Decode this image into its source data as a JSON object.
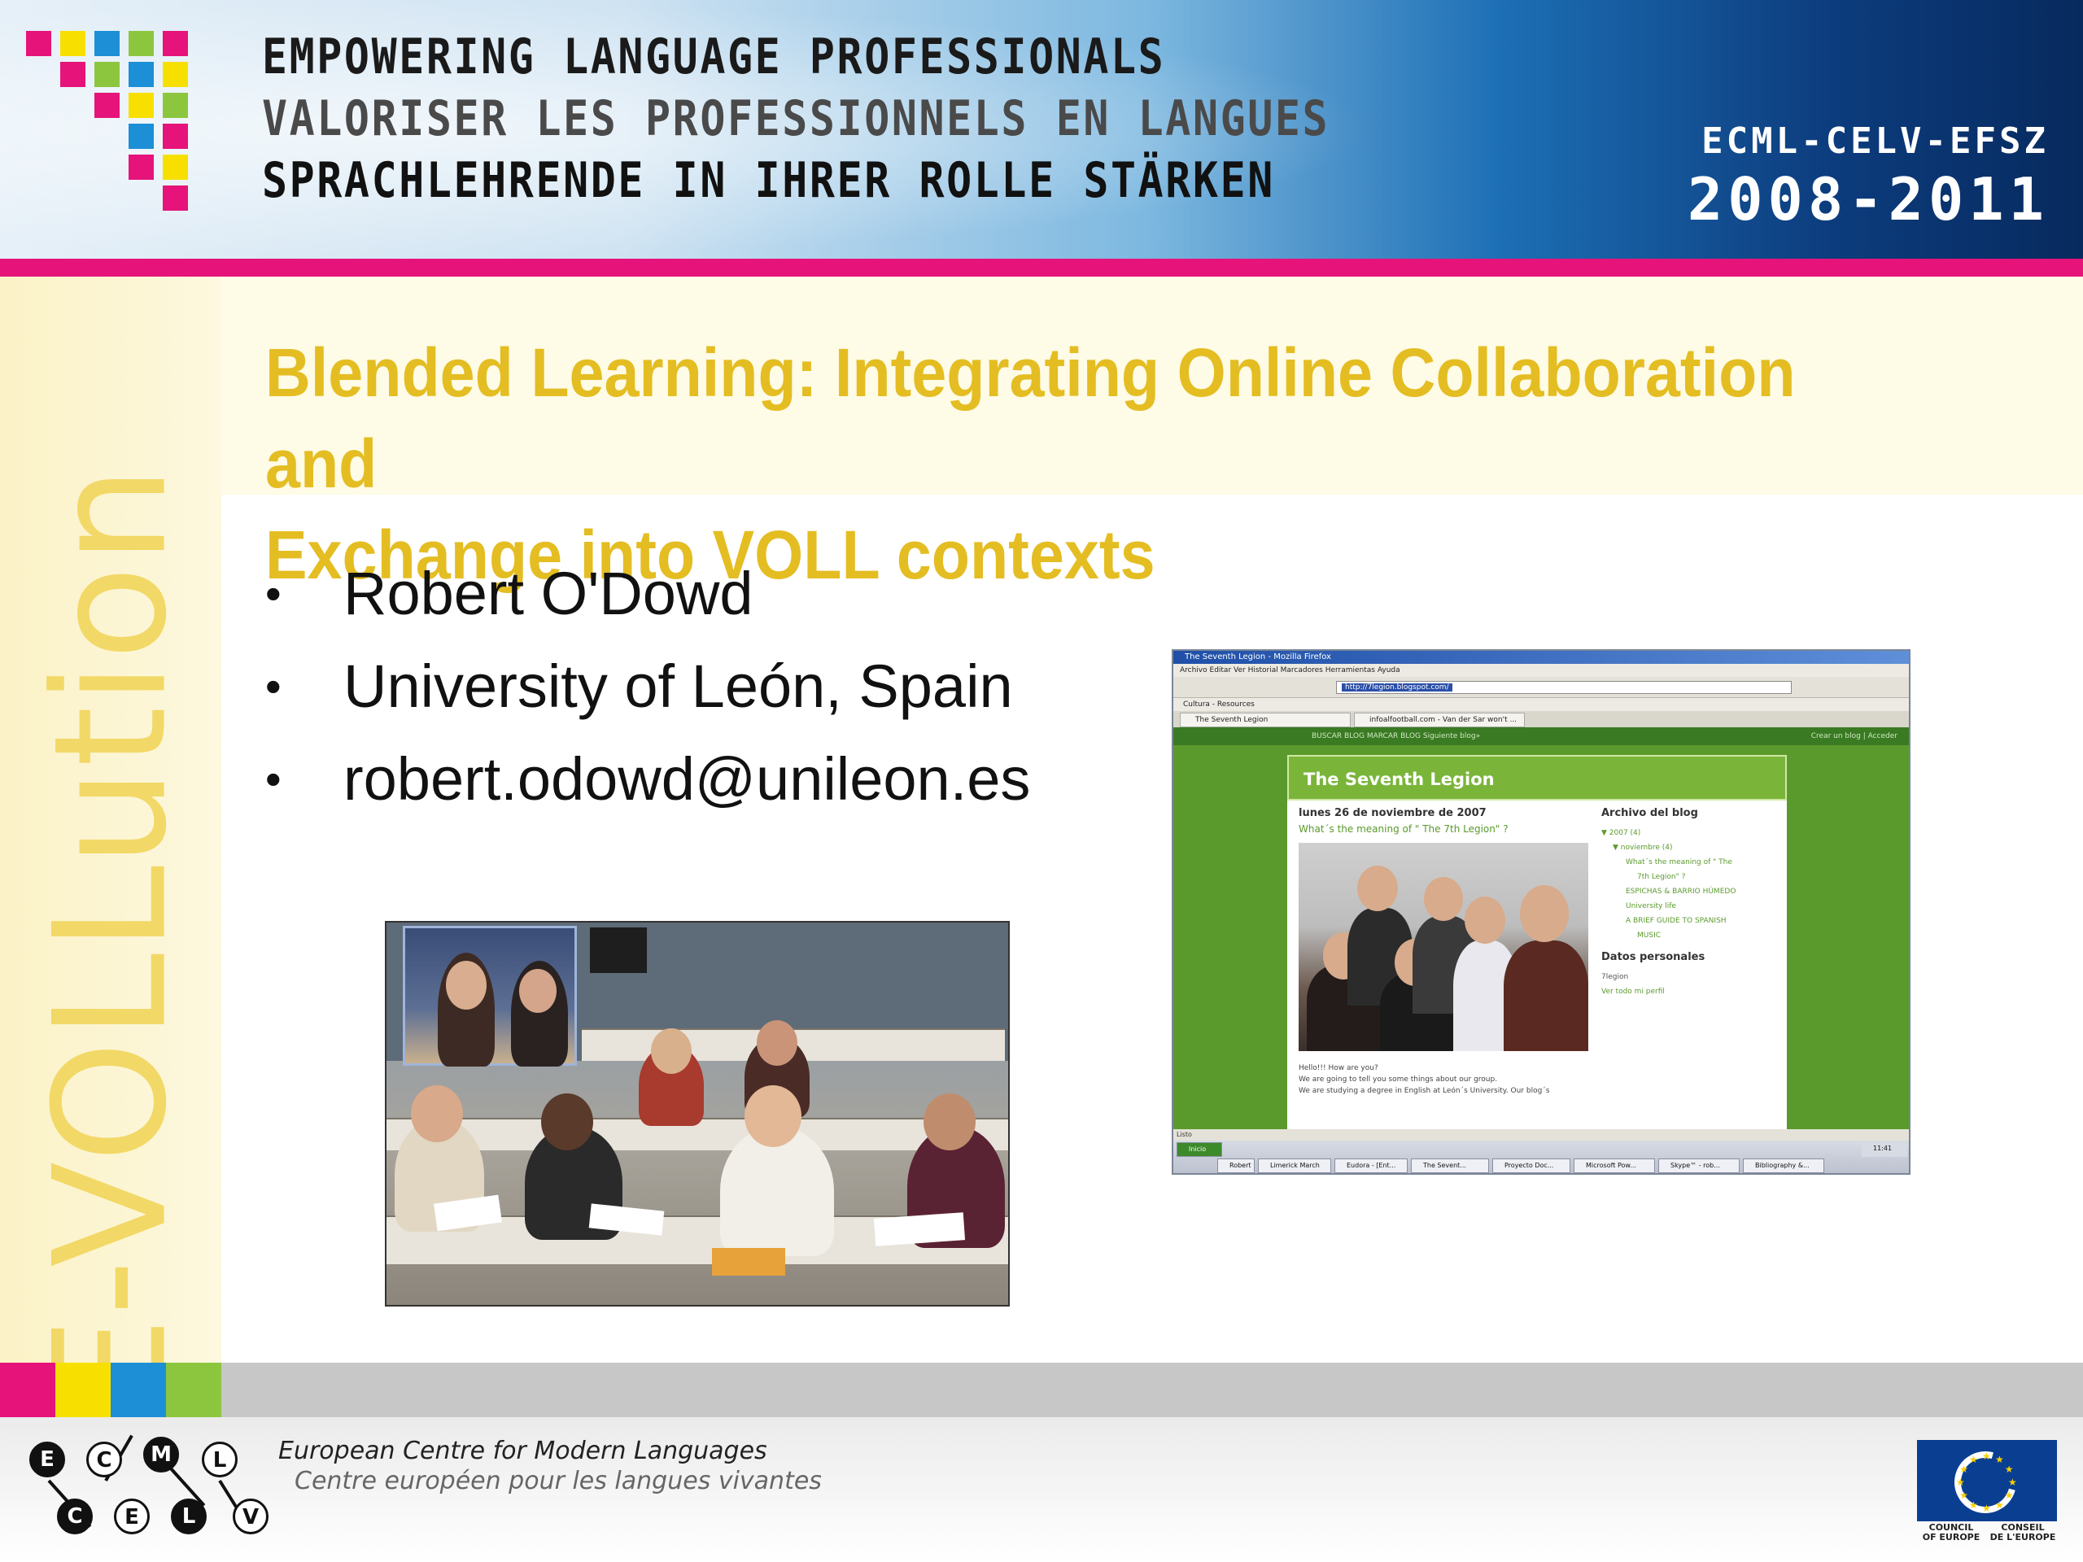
{
  "header": {
    "line1": "EMPOWERING LANGUAGE PROFESSIONALS",
    "line2": "VALORISER LES PROFESSIONNELS EN LANGUES",
    "line3": "SPRACHLEHRENDE IN IHRER ROLLE STÄRKEN",
    "orgs": "ECML-CELV-EFSZ",
    "years": "2008-2011"
  },
  "side_label": "E-VOLLution",
  "slide": {
    "title_line1": "Blended Learning: Integrating Online Collaboration and",
    "title_line2": "Exchange into VOLL contexts",
    "bullets": [
      "Robert O'Dowd",
      "University of León, Spain",
      "robert.odowd@unileon.es"
    ],
    "bullet_glyph": "•"
  },
  "blog_screenshot": {
    "window_title": "The Seventh Legion - Mozilla Firefox",
    "menu": "Archivo   Editar   Ver   Historial   Marcadores   Herramientas   Ayuda",
    "url": "http://7legion.blogspot.com/",
    "bookmarks": "Cultura - Resources",
    "tab1": "The Seventh Legion",
    "tab2": "infoalfootball.com - Van der Sar won't ...",
    "navbar": "BUSCAR BLOG    MARCAR BLOG    Siguiente blog»",
    "navbar_right": "Crear un blog | Acceder",
    "blog_title": "The Seventh Legion",
    "post_date": "lunes 26 de noviembre de 2007",
    "post_title": "What´s the meaning of \" The 7th Legion\" ?",
    "body_lines": [
      "Hello!!! How are you?",
      "We are going to tell you some things about our group.",
      "We are studying a degree in English at León´s University. Our blog´s"
    ],
    "archive_heading": "Archivo del blog",
    "archive_items": [
      "▼ 2007 (4)",
      "▼ noviembre (4)",
      "What´s the meaning of \" The",
      "7th Legion\" ?",
      "ESPICHAS & BARRIO HÚMEDO",
      "University life",
      "A BRIEF GUIDE TO SPANISH",
      "MUSIC"
    ],
    "profile_heading": "Datos personales",
    "profile_items": [
      "7legion",
      "Ver todo mi perfil"
    ],
    "status": "Listo",
    "taskbar": [
      "Inicio",
      "Robert",
      "Limerick March",
      "Eudora - [Ent...",
      "The Sevent...",
      "Proyecto Doc...",
      "Microsoft Pow...",
      "Skype™ - rob...",
      "Bibliography &..."
    ],
    "clock": "11:41"
  },
  "footer": {
    "ecml_en": "European Centre for Modern Languages",
    "ecml_fr": "Centre européen pour les langues vivantes",
    "logo_letters": [
      "E",
      "C",
      "M",
      "L",
      "C",
      "E",
      "L",
      "V"
    ],
    "coe_en": "COUNCIL\nOF EUROPE",
    "coe_fr": "CONSEIL\nDE L'EUROPE"
  },
  "colors": {
    "magenta": "#e5137a",
    "yellow": "#f7e000",
    "blue": "#1c8fd6",
    "green": "#8cc63f",
    "title_gold": "#e4bd22",
    "side_text": "#f2d866",
    "blog_green": "#5a9a2c"
  }
}
